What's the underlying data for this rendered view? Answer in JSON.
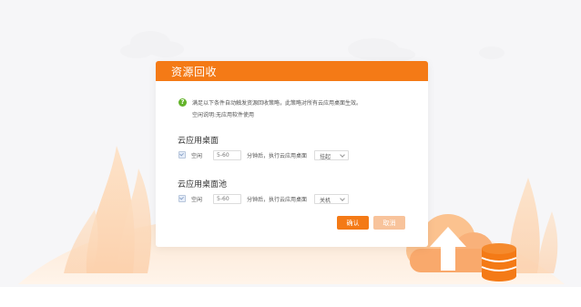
{
  "dialog": {
    "title": "资源回收",
    "hint_line1": "满足以下条件自动触发资源回收策略，此策略对所有云应用桌面生效。",
    "hint_line2": "空闲说明:无应用软件使用",
    "sections": [
      {
        "title": "云应用桌面",
        "checkbox_label": "空闲",
        "input_placeholder": "5-60",
        "text": "分钟后，执行云应用桌面",
        "select_value": "挂起"
      },
      {
        "title": "云应用桌面池",
        "checkbox_label": "空闲",
        "input_placeholder": "5-60",
        "text": "分钟后，执行云应用桌面",
        "select_value": "关机"
      }
    ],
    "buttons": {
      "confirm": "确认",
      "cancel": "取消"
    }
  },
  "colors": {
    "accent": "#f47a16",
    "accent_light": "#f8c39b",
    "hint_icon": "#63b32a"
  },
  "icons": {
    "hint": "question-circle-icon",
    "illustration": "cloud-upload-database-icon"
  }
}
